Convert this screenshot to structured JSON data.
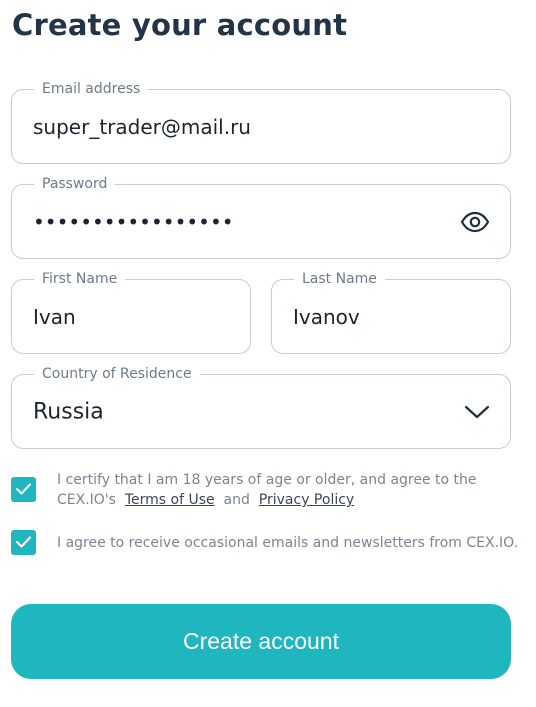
{
  "page": {
    "title": "Create your account"
  },
  "form": {
    "email": {
      "label": "Email address",
      "value": "super_trader@mail.ru"
    },
    "password": {
      "label": "Password",
      "masked_value": "•••••••••••••••••"
    },
    "first_name": {
      "label": "First Name",
      "value": "Ivan"
    },
    "last_name": {
      "label": "Last Name",
      "value": "Ivanov"
    },
    "country": {
      "label": "Country of Residence",
      "value": "Russia"
    }
  },
  "agreements": {
    "age_terms": {
      "checked": true,
      "text_line1": "I certify that I am 18 years of age or older, and agree to the",
      "text_prefix": "CEX.IO's",
      "terms_link": "Terms of Use",
      "and_text": "and",
      "privacy_link": "Privacy Policy"
    },
    "newsletter": {
      "checked": true,
      "text": "I agree to receive occasional emails and newsletters from CEX.IO."
    }
  },
  "actions": {
    "submit_label": "Create account"
  },
  "icons": {
    "password_toggle": "eye-icon",
    "country_dropdown": "chevron-down-icon",
    "checkbox_mark": "checkmark-icon"
  },
  "colors": {
    "accent": "#1fb6bf",
    "heading": "#243447",
    "border": "#c6ccd6",
    "muted_text": "#7a8593"
  }
}
